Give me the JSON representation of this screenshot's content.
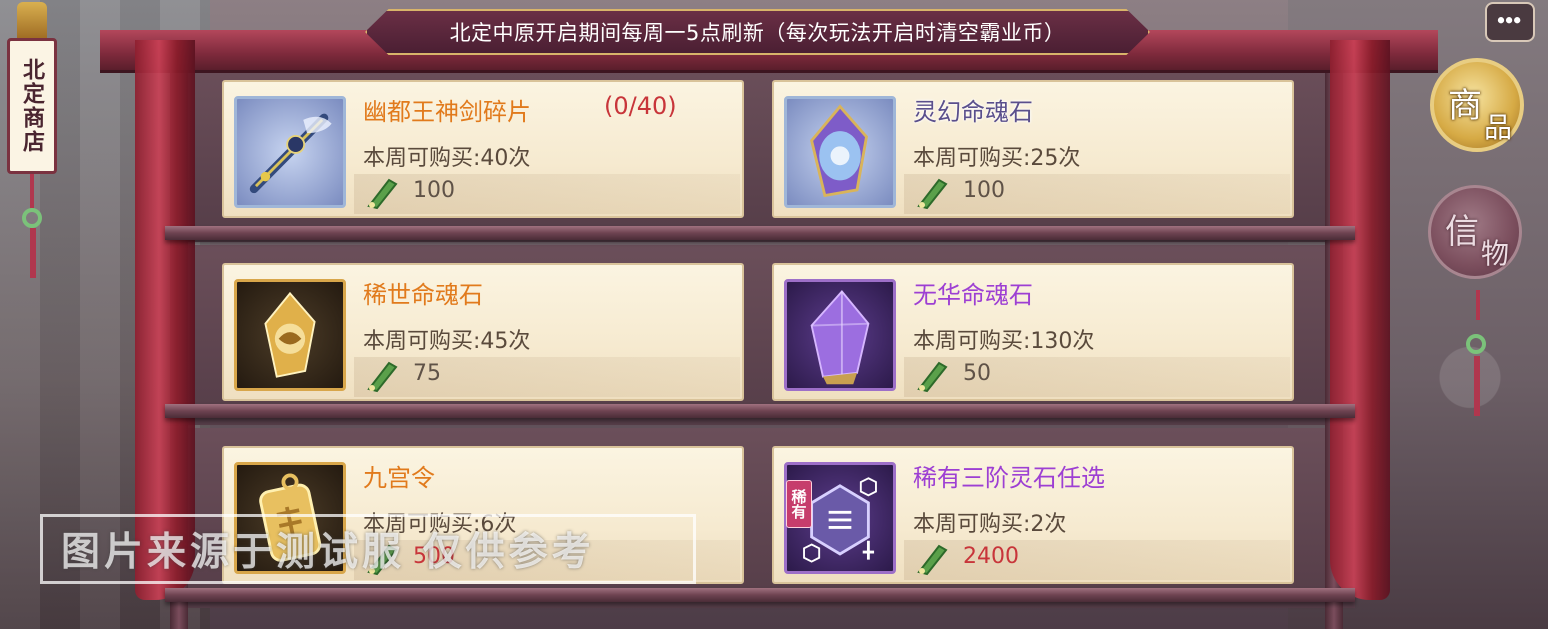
{
  "header": {
    "banner_text": "北定中原开启期间每周一5点刷新（每次玩法开启时清空霸业币）"
  },
  "shop_sign": {
    "title": "北定商店"
  },
  "side_tabs": [
    {
      "char1": "商",
      "char2": "品",
      "active": true
    },
    {
      "char1": "信",
      "char2": "物",
      "active": false
    }
  ],
  "chat": {
    "icon": "chat-bubble-icon"
  },
  "items": [
    {
      "name": "幽都王神剑碎片",
      "count": "(0/40)",
      "limit": "本周可购买:40次",
      "price": "100",
      "icon": "sword-fragment-icon",
      "name_color": "#e17a1c"
    },
    {
      "name": "灵幻命魂石",
      "count": "",
      "limit": "本周可购买:25次",
      "price": "100",
      "icon": "blue-soul-stone-icon",
      "name_color": "#5a4f8c"
    },
    {
      "name": "稀世命魂石",
      "count": "",
      "limit": "本周可购买:45次",
      "price": "75",
      "icon": "gold-soul-stone-icon",
      "name_color": "#e17a1c"
    },
    {
      "name": "无华命魂石",
      "count": "",
      "limit": "本周可购买:130次",
      "price": "50",
      "icon": "purple-soul-stone-icon",
      "name_color": "#9d3fd3"
    },
    {
      "name": "九宫令",
      "count": "",
      "limit": "本周可购买:6次",
      "price": "500",
      "icon": "gold-token-icon",
      "name_color": "#e17a1c"
    },
    {
      "name": "稀有三阶灵石任选",
      "count": "",
      "limit": "本周可购买:2次",
      "price": "2400",
      "icon": "spirit-stone-selector-icon",
      "name_color": "#9d3fd3",
      "badge": "稀有"
    }
  ],
  "currency": {
    "icon": "jade-token-currency-icon"
  },
  "watermark": {
    "text": "图片来源于测试服  仅供参考"
  }
}
